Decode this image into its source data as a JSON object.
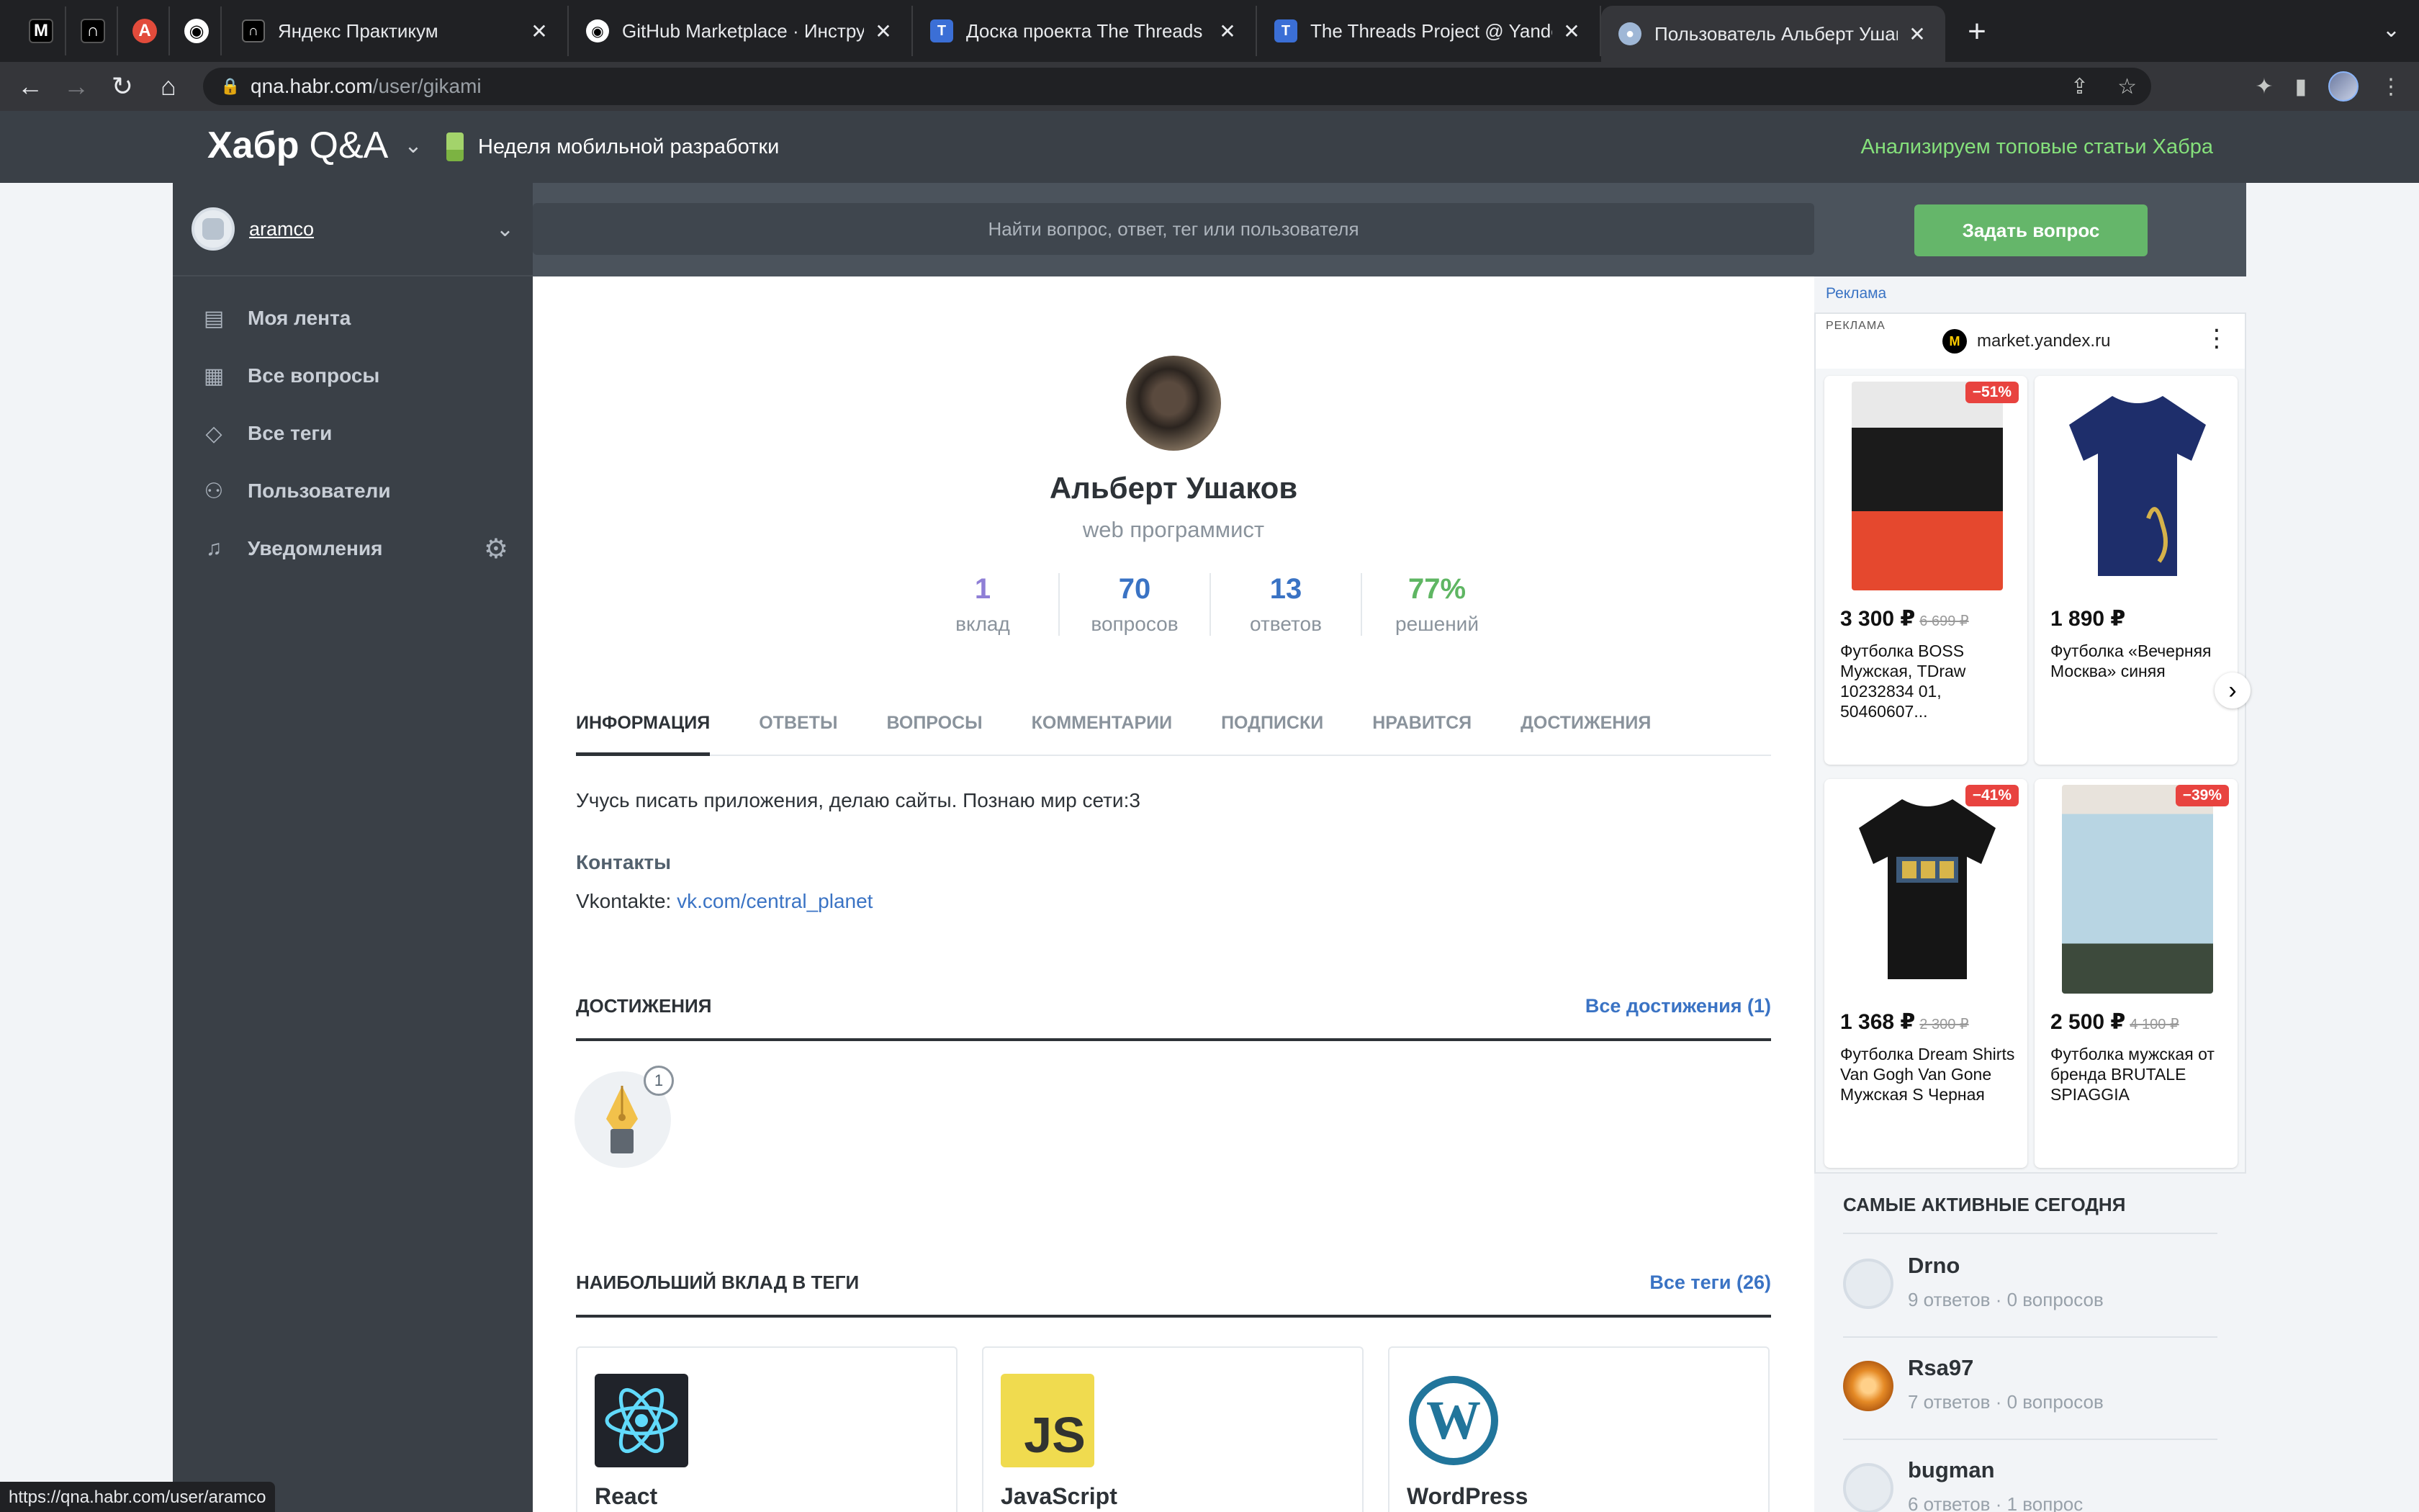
{
  "browser": {
    "pinned_tabs": [
      {
        "icon": "m-icon",
        "glyph": "M",
        "bg": "#000000"
      },
      {
        "icon": "practicum-icon",
        "glyph": "∩",
        "bg": "#000000"
      },
      {
        "icon": "app-icon",
        "glyph": "A",
        "bg": "#e24b3b"
      },
      {
        "icon": "github-icon",
        "glyph": "◉",
        "bg": "#202124"
      }
    ],
    "tabs": [
      {
        "title": "Яндекс Практикум",
        "icon": "practicum-icon"
      },
      {
        "title": "GitHub Marketplace · Инструм",
        "icon": "github-icon"
      },
      {
        "title": "Доска проекта The Threads P",
        "icon": "threads-icon"
      },
      {
        "title": "The Threads Project @ Yandex",
        "icon": "threads-icon"
      },
      {
        "title": "Пользователь Альберт Ушако",
        "icon": "habr-icon",
        "active": true
      }
    ],
    "url_host": "qna.habr.com",
    "url_path": "/user/gikami",
    "status_url": "https://qna.habr.com/user/aramco"
  },
  "header": {
    "logo": "Хабр",
    "logo_suffix": "Q&A",
    "promo": "Неделя мобильной разработки",
    "right_link": "Анализируем топовые статьи Хабра"
  },
  "sidebar": {
    "username": "aramco",
    "items": [
      {
        "label": "Моя лента",
        "icon": "feed-icon"
      },
      {
        "label": "Все вопросы",
        "icon": "questions-icon"
      },
      {
        "label": "Все теги",
        "icon": "tag-icon"
      },
      {
        "label": "Пользователи",
        "icon": "users-icon"
      },
      {
        "label": "Уведомления",
        "icon": "bell-icon"
      }
    ]
  },
  "search": {
    "placeholder": "Найти вопрос, ответ, тег или пользователя",
    "ask_button": "Задать вопрос"
  },
  "profile": {
    "name": "Альберт Ушаков",
    "role": "web программист",
    "stats": [
      {
        "value": "1",
        "label": "вклад",
        "color": "#8f7fd6"
      },
      {
        "value": "70",
        "label": "вопросов",
        "color": "#3a73c4"
      },
      {
        "value": "13",
        "label": "ответов",
        "color": "#3a73c4"
      },
      {
        "value": "77%",
        "label": "решений",
        "color": "#5fb663"
      }
    ],
    "tabs": [
      "ИНФОРМАЦИЯ",
      "ОТВЕТЫ",
      "ВОПРОСЫ",
      "КОММЕНТАРИИ",
      "ПОДПИСКИ",
      "НРАВИТСЯ",
      "ДОСТИЖЕНИЯ"
    ],
    "about": "Учусь писать приложения, делаю сайты. Познаю мир сети:3",
    "contacts_title": "Контакты",
    "contact_label": "Vkontakte:",
    "contact_link": "vk.com/central_planet",
    "achievements_title": "ДОСТИЖЕНИЯ",
    "achievements_link": "Все достижения (1)",
    "badge_count": "1",
    "tags_title": "НАИБОЛЬШИЙ ВКЛАД В ТЕГИ",
    "tags_link": "Все теги (26)",
    "top_tags": [
      {
        "name": "React",
        "icon": "react-icon"
      },
      {
        "name": "JavaScript",
        "icon": "javascript-icon"
      },
      {
        "name": "WordPress",
        "icon": "wordpress-icon"
      }
    ]
  },
  "ad": {
    "label": "Реклама",
    "tag": "РЕКЛАМА",
    "site": "market.yandex.ru",
    "products": [
      {
        "discount": "−51%",
        "price": "3 300 ₽",
        "old_price": "6 699 ₽",
        "name": "Футболка BOSS Мужская, TDraw 10232834 01, 50460607..."
      },
      {
        "discount": "",
        "price": "1 890 ₽",
        "old_price": "",
        "name": "Футболка «Вечерняя Москва» синяя"
      },
      {
        "discount": "−41%",
        "price": "1 368 ₽",
        "old_price": "2 300 ₽",
        "name": "Футболка Dream Shirts Van Gogh Van Gone Мужская S Черная"
      },
      {
        "discount": "−39%",
        "price": "2 500 ₽",
        "old_price": "4 100 ₽",
        "name": "Футболка мужская от бренда BRUTALE SPIAGGIA"
      }
    ]
  },
  "active_today": {
    "title": "САМЫЕ АКТИВНЫЕ СЕГОДНЯ",
    "users": [
      {
        "name": "Drno",
        "meta": "9 ответов · 0 вопросов"
      },
      {
        "name": "Rsa97",
        "meta": "7 ответов · 0 вопросов"
      },
      {
        "name": "bugman",
        "meta": "6 ответов · 1 вопрос"
      }
    ]
  }
}
